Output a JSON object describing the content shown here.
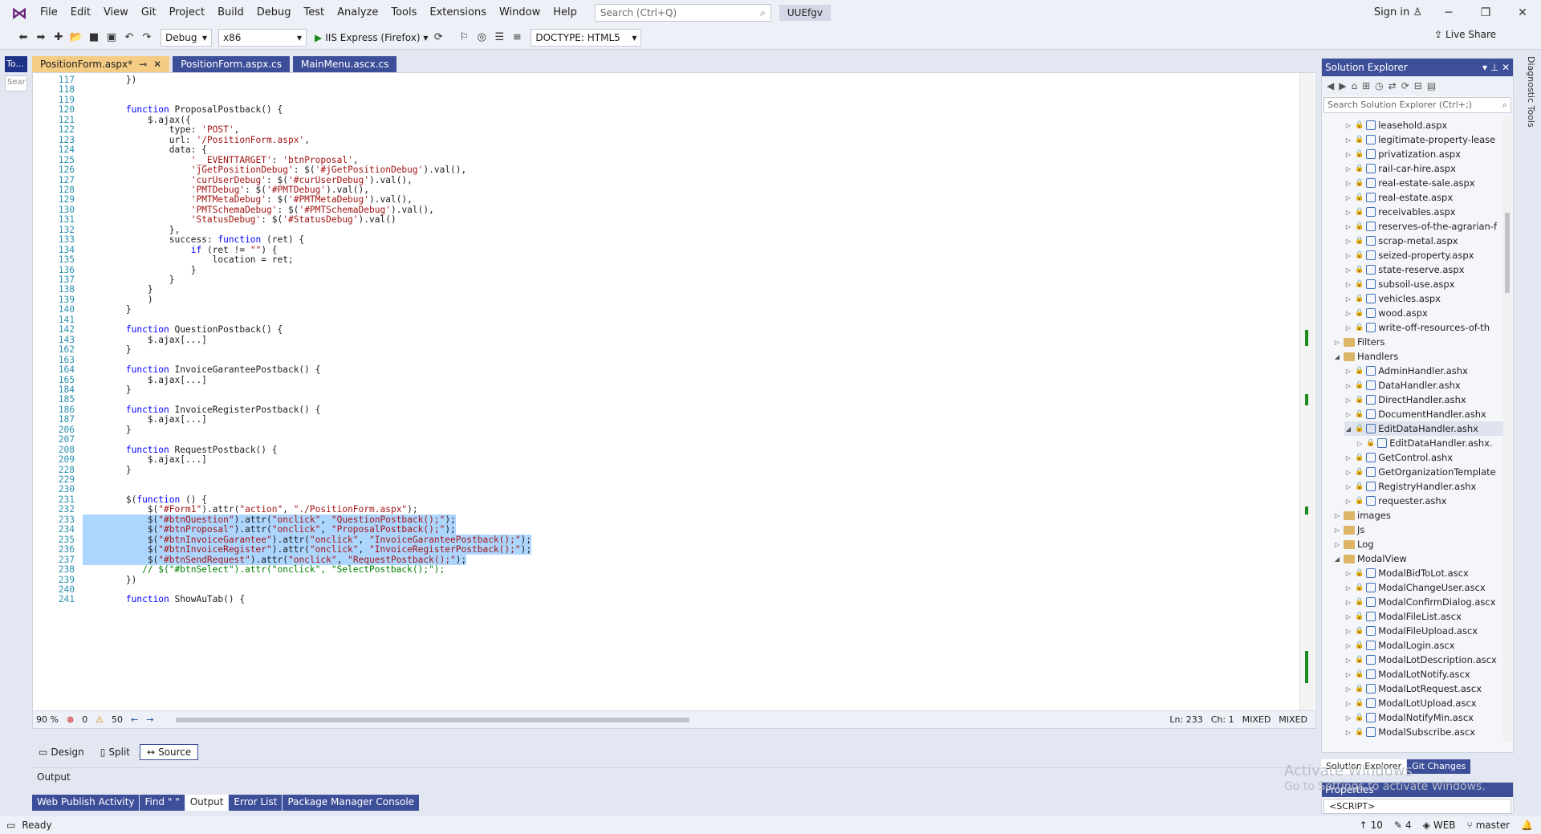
{
  "titlebar": {
    "menu": [
      "File",
      "Edit",
      "View",
      "Git",
      "Project",
      "Build",
      "Debug",
      "Test",
      "Analyze",
      "Tools",
      "Extensions",
      "Window",
      "Help"
    ],
    "search_placeholder": "Search (Ctrl+Q)",
    "solution_name": "UUEfgv",
    "sign_in": "Sign in"
  },
  "toolbar": {
    "configuration": "Debug",
    "platform": "x86",
    "run_target": "IIS Express (Firefox)",
    "doctype": "DOCTYPE: HTML5",
    "live_share": "Live Share"
  },
  "toolbox": {
    "tab": "To...",
    "search": "Sear"
  },
  "doc_tabs": [
    {
      "label": "PositionForm.aspx*",
      "active": true
    },
    {
      "label": "PositionForm.aspx.cs",
      "active": false
    },
    {
      "label": "MainMenu.ascx.cs",
      "active": false
    }
  ],
  "code_lines": [
    {
      "n": "117",
      "t": "        })"
    },
    {
      "n": "118",
      "t": ""
    },
    {
      "n": "119",
      "t": ""
    },
    {
      "n": "120",
      "t": "        function ProposalPostback() {"
    },
    {
      "n": "121",
      "t": "            $.ajax({"
    },
    {
      "n": "122",
      "t": "                type: 'POST',"
    },
    {
      "n": "123",
      "t": "                url: '/PositionForm.aspx',"
    },
    {
      "n": "124",
      "t": "                data: {"
    },
    {
      "n": "125",
      "t": "                    '__EVENTTARGET': 'btnProposal',"
    },
    {
      "n": "126",
      "t": "                    'jGetPositionDebug': $('#jGetPositionDebug').val(),"
    },
    {
      "n": "127",
      "t": "                    'curUserDebug': $('#curUserDebug').val(),"
    },
    {
      "n": "128",
      "t": "                    'PMTDebug': $('#PMTDebug').val(),"
    },
    {
      "n": "129",
      "t": "                    'PMTMetaDebug': $('#PMTMetaDebug').val(),"
    },
    {
      "n": "130",
      "t": "                    'PMTSchemaDebug': $('#PMTSchemaDebug').val(),"
    },
    {
      "n": "131",
      "t": "                    'StatusDebug': $('#StatusDebug').val()"
    },
    {
      "n": "132",
      "t": "                },"
    },
    {
      "n": "133",
      "t": "                success: function (ret) {"
    },
    {
      "n": "134",
      "t": "                    if (ret != \"\") {"
    },
    {
      "n": "135",
      "t": "                        location = ret;"
    },
    {
      "n": "136",
      "t": "                    }"
    },
    {
      "n": "137",
      "t": "                }"
    },
    {
      "n": "138",
      "t": "            }"
    },
    {
      "n": "139",
      "t": "            )"
    },
    {
      "n": "140",
      "t": "        }"
    },
    {
      "n": "141",
      "t": ""
    },
    {
      "n": "142",
      "t": "        function QuestionPostback() {"
    },
    {
      "n": "143",
      "t": "            $.ajax[...]"
    },
    {
      "n": "162",
      "t": "        }"
    },
    {
      "n": "163",
      "t": ""
    },
    {
      "n": "164",
      "t": "        function InvoiceGaranteePostback() {"
    },
    {
      "n": "165",
      "t": "            $.ajax[...]"
    },
    {
      "n": "184",
      "t": "        }"
    },
    {
      "n": "185",
      "t": ""
    },
    {
      "n": "186",
      "t": "        function InvoiceRegisterPostback() {"
    },
    {
      "n": "187",
      "t": "            $.ajax[...]"
    },
    {
      "n": "206",
      "t": "        }"
    },
    {
      "n": "207",
      "t": ""
    },
    {
      "n": "208",
      "t": "        function RequestPostback() {"
    },
    {
      "n": "209",
      "t": "            $.ajax[...]"
    },
    {
      "n": "228",
      "t": "        }"
    },
    {
      "n": "229",
      "t": ""
    },
    {
      "n": "230",
      "t": ""
    },
    {
      "n": "231",
      "t": "        $(function () {"
    },
    {
      "n": "232",
      "t": "            $(\"#Form1\").attr(\"action\", \"./PositionForm.aspx\");"
    },
    {
      "n": "233",
      "t": "            $(\"#btnQuestion\").attr(\"onclick\", \"QuestionPostback();\");",
      "sel": true
    },
    {
      "n": "234",
      "t": "            $(\"#btnProposal\").attr(\"onclick\", \"ProposalPostback();\");",
      "sel": true
    },
    {
      "n": "235",
      "t": "            $(\"#btnInvoiceGarantee\").attr(\"onclick\", \"InvoiceGaranteePostback();\");",
      "sel": true
    },
    {
      "n": "236",
      "t": "            $(\"#btnInvoiceRegister\").attr(\"onclick\", \"InvoiceRegisterPostback();\");",
      "sel": true
    },
    {
      "n": "237",
      "t": "            $(\"#btnSendRequest\").attr(\"onclick\", \"RequestPostback();\");",
      "sel": true
    },
    {
      "n": "238",
      "t": "           // $(\"#btnSelect\").attr(\"onclick\", \"SelectPostback();\");"
    },
    {
      "n": "239",
      "t": "        })"
    },
    {
      "n": "240",
      "t": ""
    },
    {
      "n": "241",
      "t": "        function ShowAuTab() {"
    }
  ],
  "editor_status": {
    "zoom": "90 %",
    "errors": "0",
    "warnings": "50",
    "line": "Ln: 233",
    "col": "Ch: 1",
    "mode1": "MIXED",
    "mode2": "MIXED"
  },
  "view_tabs": [
    {
      "label": "Design",
      "active": false
    },
    {
      "label": "Split",
      "active": false
    },
    {
      "label": "Source",
      "active": true
    }
  ],
  "output": {
    "title": "Output"
  },
  "bottom_tabs": [
    {
      "label": "Web Publish Activity",
      "active": false
    },
    {
      "label": "Find \" \"",
      "active": false
    },
    {
      "label": "Output",
      "active": true
    },
    {
      "label": "Error List",
      "active": false
    },
    {
      "label": "Package Manager Console",
      "active": false
    }
  ],
  "solution_explorer": {
    "title": "Solution Explorer",
    "search_placeholder": "Search Solution Explorer (Ctrl+;)",
    "items": [
      {
        "label": "leasehold.aspx",
        "lvl": 2,
        "type": "file"
      },
      {
        "label": "legitimate-property-lease",
        "lvl": 2,
        "type": "file"
      },
      {
        "label": "privatization.aspx",
        "lvl": 2,
        "type": "file"
      },
      {
        "label": "rail-car-hire.aspx",
        "lvl": 2,
        "type": "file"
      },
      {
        "label": "real-estate-sale.aspx",
        "lvl": 2,
        "type": "file"
      },
      {
        "label": "real-estate.aspx",
        "lvl": 2,
        "type": "file"
      },
      {
        "label": "receivables.aspx",
        "lvl": 2,
        "type": "file"
      },
      {
        "label": "reserves-of-the-agrarian-f",
        "lvl": 2,
        "type": "file"
      },
      {
        "label": "scrap-metal.aspx",
        "lvl": 2,
        "type": "file"
      },
      {
        "label": "seized-property.aspx",
        "lvl": 2,
        "type": "file"
      },
      {
        "label": "state-reserve.aspx",
        "lvl": 2,
        "type": "file"
      },
      {
        "label": "subsoil-use.aspx",
        "lvl": 2,
        "type": "file"
      },
      {
        "label": "vehicles.aspx",
        "lvl": 2,
        "type": "file"
      },
      {
        "label": "wood.aspx",
        "lvl": 2,
        "type": "file"
      },
      {
        "label": "write-off-resources-of-th",
        "lvl": 2,
        "type": "file"
      },
      {
        "label": "Filters",
        "lvl": 1,
        "type": "folder"
      },
      {
        "label": "Handlers",
        "lvl": 1,
        "type": "folder-open"
      },
      {
        "label": "AdminHandler.ashx",
        "lvl": 2,
        "type": "file"
      },
      {
        "label": "DataHandler.ashx",
        "lvl": 2,
        "type": "file"
      },
      {
        "label": "DirectHandler.ashx",
        "lvl": 2,
        "type": "file"
      },
      {
        "label": "DocumentHandler.ashx",
        "lvl": 2,
        "type": "file"
      },
      {
        "label": "EditDataHandler.ashx",
        "lvl": 2,
        "type": "file-open",
        "hl": true
      },
      {
        "label": "EditDataHandler.ashx.",
        "lvl": 3,
        "type": "file"
      },
      {
        "label": "GetControl.ashx",
        "lvl": 2,
        "type": "file"
      },
      {
        "label": "GetOrganizationTemplate",
        "lvl": 2,
        "type": "file"
      },
      {
        "label": "RegistryHandler.ashx",
        "lvl": 2,
        "type": "file"
      },
      {
        "label": "requester.ashx",
        "lvl": 2,
        "type": "file"
      },
      {
        "label": "images",
        "lvl": 1,
        "type": "folder"
      },
      {
        "label": "Js",
        "lvl": 1,
        "type": "folder"
      },
      {
        "label": "Log",
        "lvl": 1,
        "type": "folder"
      },
      {
        "label": "ModalView",
        "lvl": 1,
        "type": "folder-open"
      },
      {
        "label": "ModalBidToLot.ascx",
        "lvl": 2,
        "type": "file"
      },
      {
        "label": "ModalChangeUser.ascx",
        "lvl": 2,
        "type": "file"
      },
      {
        "label": "ModalConfirmDialog.ascx",
        "lvl": 2,
        "type": "file"
      },
      {
        "label": "ModalFileList.ascx",
        "lvl": 2,
        "type": "file"
      },
      {
        "label": "ModalFileUpload.ascx",
        "lvl": 2,
        "type": "file"
      },
      {
        "label": "ModalLogin.ascx",
        "lvl": 2,
        "type": "file"
      },
      {
        "label": "ModalLotDescription.ascx",
        "lvl": 2,
        "type": "file"
      },
      {
        "label": "ModalLotNotify.ascx",
        "lvl": 2,
        "type": "file"
      },
      {
        "label": "ModalLotRequest.ascx",
        "lvl": 2,
        "type": "file"
      },
      {
        "label": "ModalLotUpload.ascx",
        "lvl": 2,
        "type": "file"
      },
      {
        "label": "ModalNotifyMin.ascx",
        "lvl": 2,
        "type": "file"
      },
      {
        "label": "ModalSubscribe.ascx",
        "lvl": 2,
        "type": "file"
      }
    ]
  },
  "se_tabs": [
    "Solution Explorer",
    "Git Changes"
  ],
  "properties": {
    "title": "Properties",
    "value": "<SCRIPT>"
  },
  "diagnostic_tools": "Diagnostic Tools",
  "watermark": {
    "line1": "Activate Windows",
    "line2": "Go to Settings to activate Windows."
  },
  "statusbar": {
    "ready": "Ready",
    "up": "10",
    "pencil": "4",
    "web": "WEB",
    "branch": "master"
  }
}
